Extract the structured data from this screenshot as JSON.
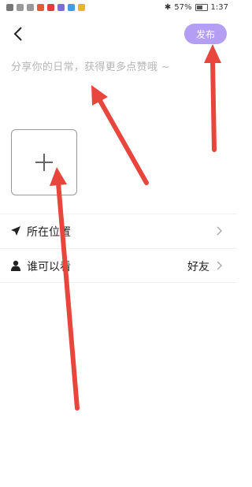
{
  "status_bar": {
    "battery": "57%",
    "time": "1:37"
  },
  "header": {
    "publish_label": "发布"
  },
  "post_input": {
    "placeholder": "分享你的日常，获得更多点赞哦 ~"
  },
  "settings": {
    "location_label": "所在位置",
    "visibility_label": "谁可以看",
    "visibility_value": "好友"
  },
  "colors": {
    "accent": "#b39ef3",
    "annotation_arrow": "#e8453c"
  },
  "icons": {
    "back": "chevron-left-icon",
    "add": "plus-icon",
    "location": "location-arrow-icon",
    "visibility": "person-icon",
    "row_chevron": "chevron-right-icon"
  }
}
